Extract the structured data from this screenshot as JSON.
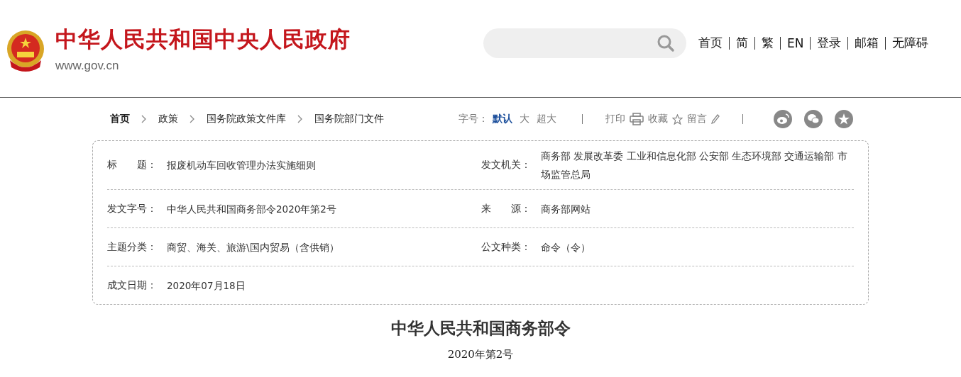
{
  "header": {
    "site_title": "中华人民共和国中央人民政府",
    "site_url": "www.gov.cn",
    "nav": [
      "首页",
      "简",
      "繁",
      "EN",
      "登录",
      "邮箱",
      "无障碍"
    ]
  },
  "breadcrumb": [
    "首页",
    "政策",
    "国务院政策文件库",
    "国务院部门文件"
  ],
  "toolbar": {
    "font_label": "字号：",
    "font_sizes": [
      {
        "label": "默认",
        "selected": true
      },
      {
        "label": "大",
        "selected": false
      },
      {
        "label": "超大",
        "selected": false
      }
    ],
    "print": "打印",
    "favorite": "收藏",
    "comment": "留言"
  },
  "info_rows": [
    {
      "left": {
        "label": "标　　题：",
        "value": "报废机动车回收管理办法实施细则"
      },
      "right": {
        "label": "发文机关：",
        "value": "商务部 发展改革委 工业和信息化部 公安部 生态环境部 交通运输部 市场监管总局"
      }
    },
    {
      "left": {
        "label": "发文字号：",
        "value": "中华人民共和国商务部令2020年第2号"
      },
      "right": {
        "label": "来　　源：",
        "value": "商务部网站"
      }
    },
    {
      "left": {
        "label": "主题分类：",
        "value": "商贸、海关、旅游\\国内贸易（含供销）"
      },
      "right": {
        "label": "公文种类：",
        "value": "命令（令）"
      }
    },
    {
      "left": {
        "label": "成文日期：",
        "value": "2020年07月18日"
      }
    }
  ],
  "document": {
    "title": "中华人民共和国商务部令",
    "number": "2020年第2号"
  }
}
